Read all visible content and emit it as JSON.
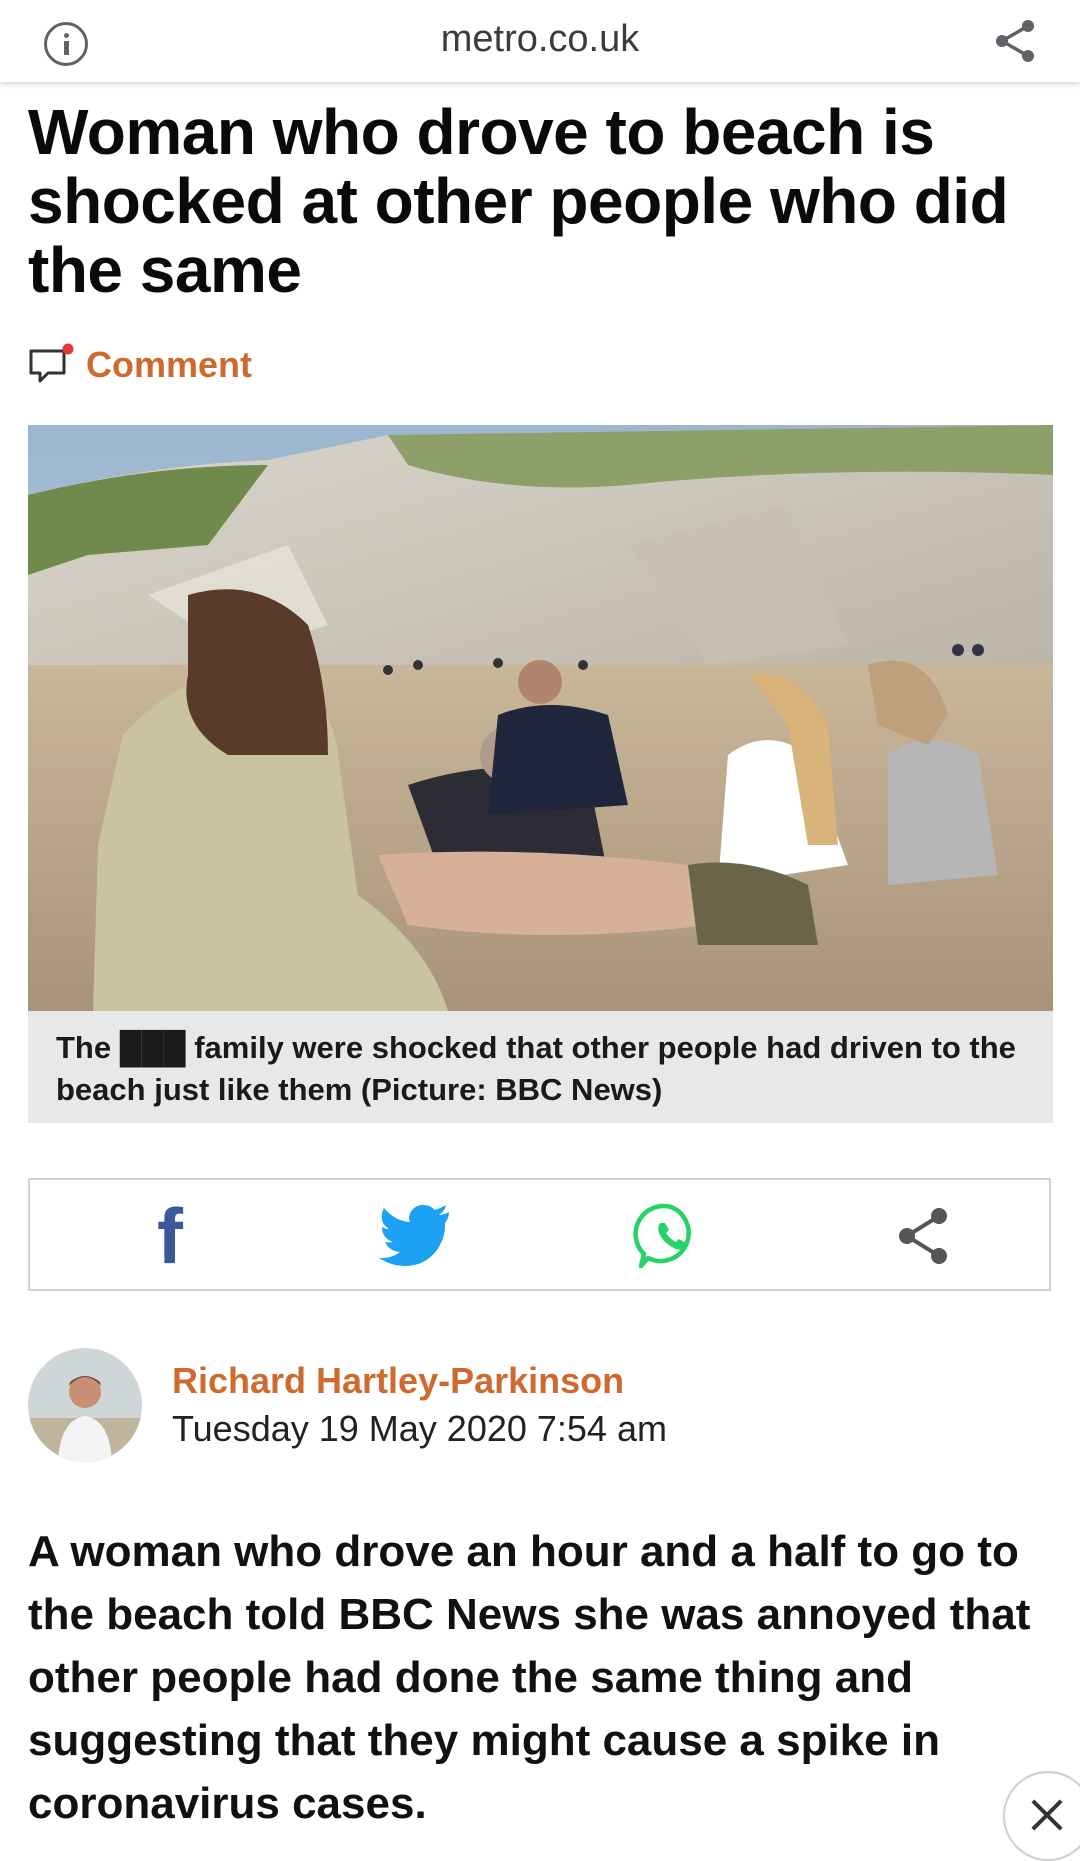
{
  "browser": {
    "url": "metro.co.uk",
    "info_icon": "info-icon",
    "share_icon": "share-icon"
  },
  "article": {
    "headline": "Woman who drove to beach is shocked at other people who did the same",
    "comment_label": "Comment",
    "photo_caption": "The ███ family were shocked that other people had driven to the beach just like them (Picture: BBC News)",
    "author_name": "Richard Hartley-Parkinson",
    "published": "Tuesday 19 May 2020 7:54 am",
    "lede": "A woman who drove an hour and a half to go to the beach told BBC News she was annoyed that other people had done the same thing and suggesting that they might cause a spike in coronavirus cases."
  },
  "share_bar": {
    "facebook_label": "f",
    "icons": [
      "facebook-icon",
      "twitter-icon",
      "whatsapp-icon",
      "share-icon"
    ]
  },
  "colors": {
    "accent": "#cf6a2e",
    "facebook": "#3b5998",
    "twitter": "#1da1f2",
    "whatsapp": "#25d366",
    "caption_bg": "#e8e8e8"
  }
}
